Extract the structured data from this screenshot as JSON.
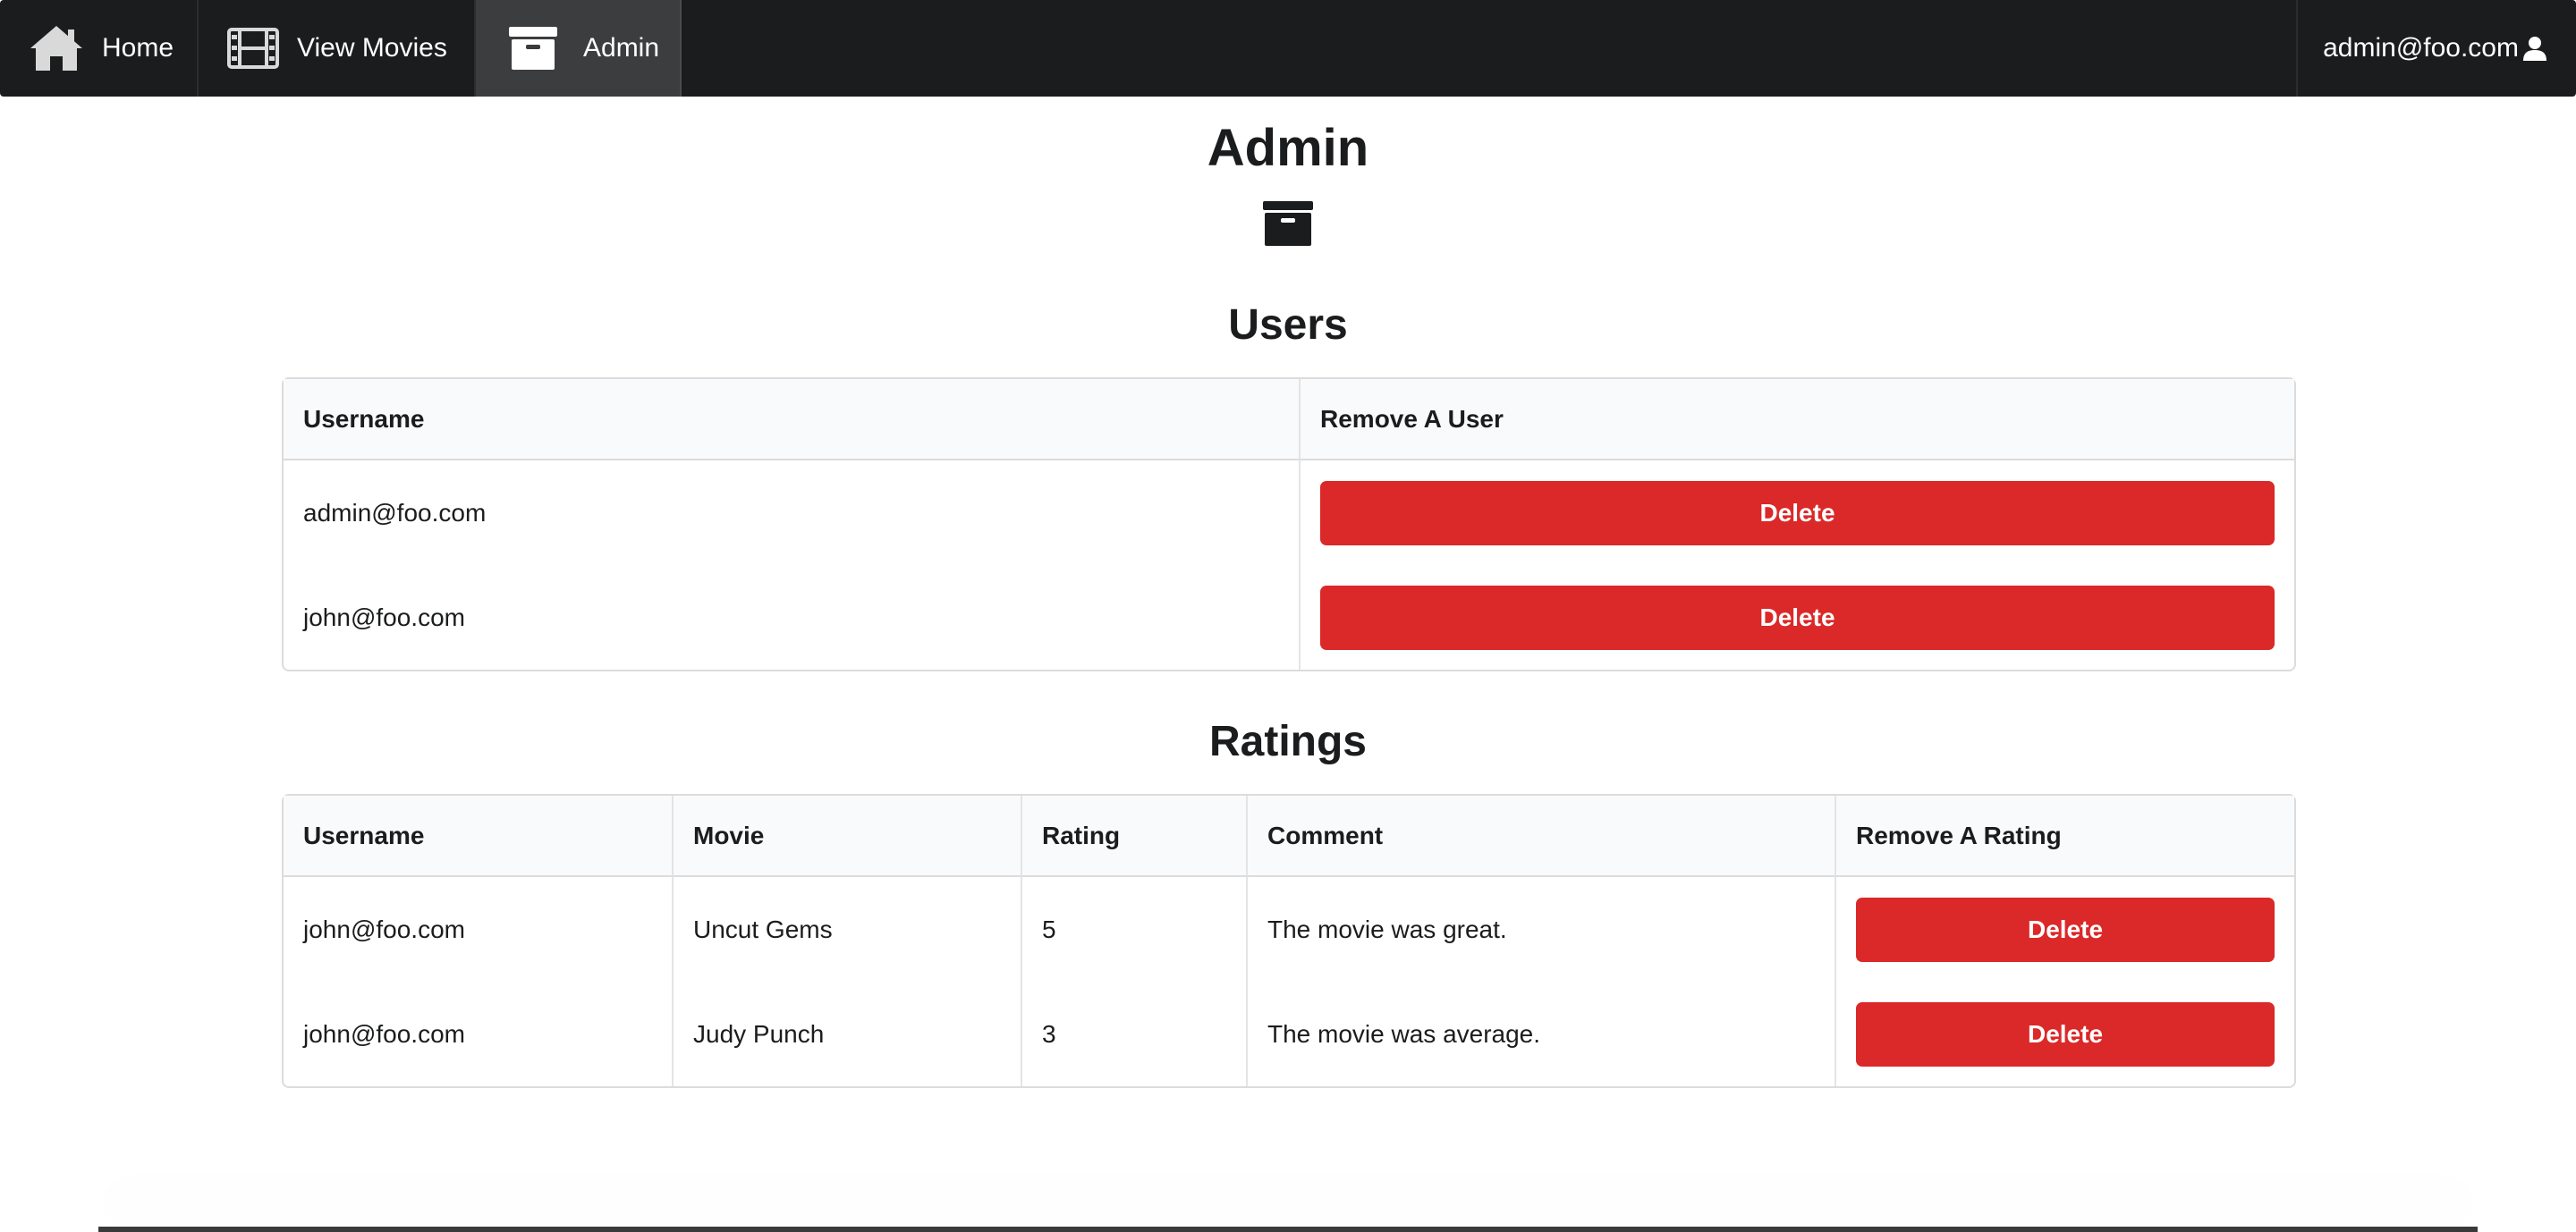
{
  "nav": {
    "home_label": "Home",
    "movies_label": "View Movies",
    "admin_label": "Admin",
    "user_email": "admin@foo.com",
    "icons": [
      "home-icon",
      "film-icon",
      "archive-icon",
      "user-icon"
    ]
  },
  "page": {
    "title": "Admin",
    "icon": "archive-icon"
  },
  "users": {
    "title": "Users",
    "columns": [
      "Username",
      "Remove A User"
    ],
    "rows": [
      {
        "username": "admin@foo.com",
        "action": "Delete"
      },
      {
        "username": "john@foo.com",
        "action": "Delete"
      }
    ]
  },
  "ratings": {
    "title": "Ratings",
    "columns": [
      "Username",
      "Movie",
      "Rating",
      "Comment",
      "Remove A Rating"
    ],
    "rows": [
      {
        "username": "john@foo.com",
        "movie": "Uncut Gems",
        "rating": "5",
        "comment": "The movie was great.",
        "action": "Delete"
      },
      {
        "username": "john@foo.com",
        "movie": "Judy Punch",
        "rating": "3",
        "comment": "The movie was average.",
        "action": "Delete"
      }
    ]
  },
  "colors": {
    "menu_bg": "#1b1c1d",
    "delete_red": "#db2828",
    "header_bg": "#f9fafb"
  }
}
